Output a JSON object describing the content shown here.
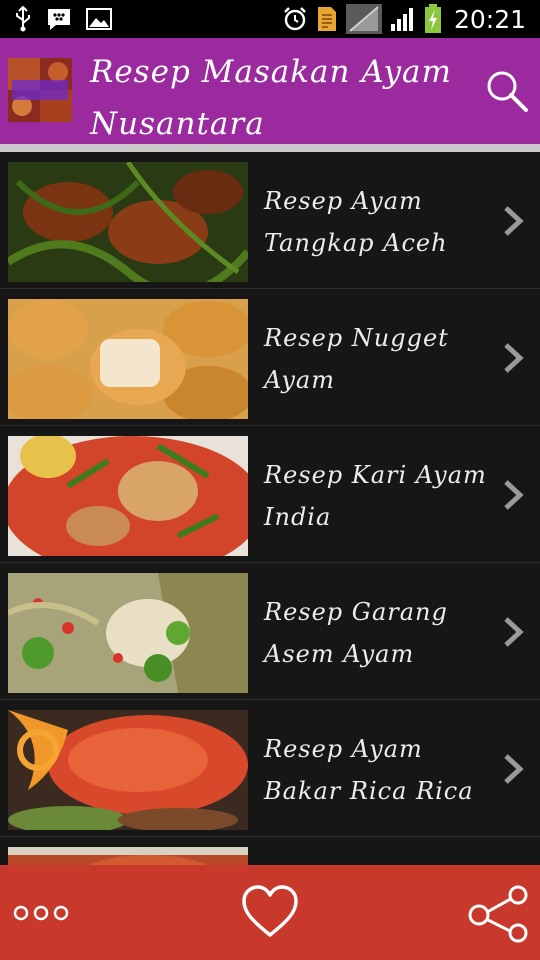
{
  "status_bar": {
    "time": "20:21",
    "left_icons": [
      "usb-icon",
      "bbm-icon",
      "image-icon"
    ],
    "right_icons": [
      "alarm-icon",
      "document-icon",
      "no-signal-icon",
      "signal-icon",
      "battery-charging-icon"
    ]
  },
  "app_bar": {
    "title": "Resep Masakan Ayam Nusantara",
    "logo_text": [
      "RESEP",
      "MASAKAN",
      "AYAM",
      "NUSANTARA"
    ],
    "background": "#9b2a9f"
  },
  "recipes": [
    {
      "label": "Resep Ayam Tangkap Aceh",
      "image": "ayam-tangkap-photo"
    },
    {
      "label": "Resep Nugget Ayam",
      "image": "nugget-photo"
    },
    {
      "label": "Resep Kari Ayam India",
      "image": "kari-photo"
    },
    {
      "label": "Resep Garang Asem Ayam",
      "image": "garang-asem-photo"
    },
    {
      "label": "Resep Ayam Bakar Rica Rica",
      "image": "ayam-bakar-photo"
    },
    {
      "label": "",
      "image": "partial-photo"
    }
  ],
  "bottom_bar": {
    "background": "#c8382b",
    "icons": [
      "more-icon",
      "heart-icon",
      "share-icon"
    ]
  }
}
